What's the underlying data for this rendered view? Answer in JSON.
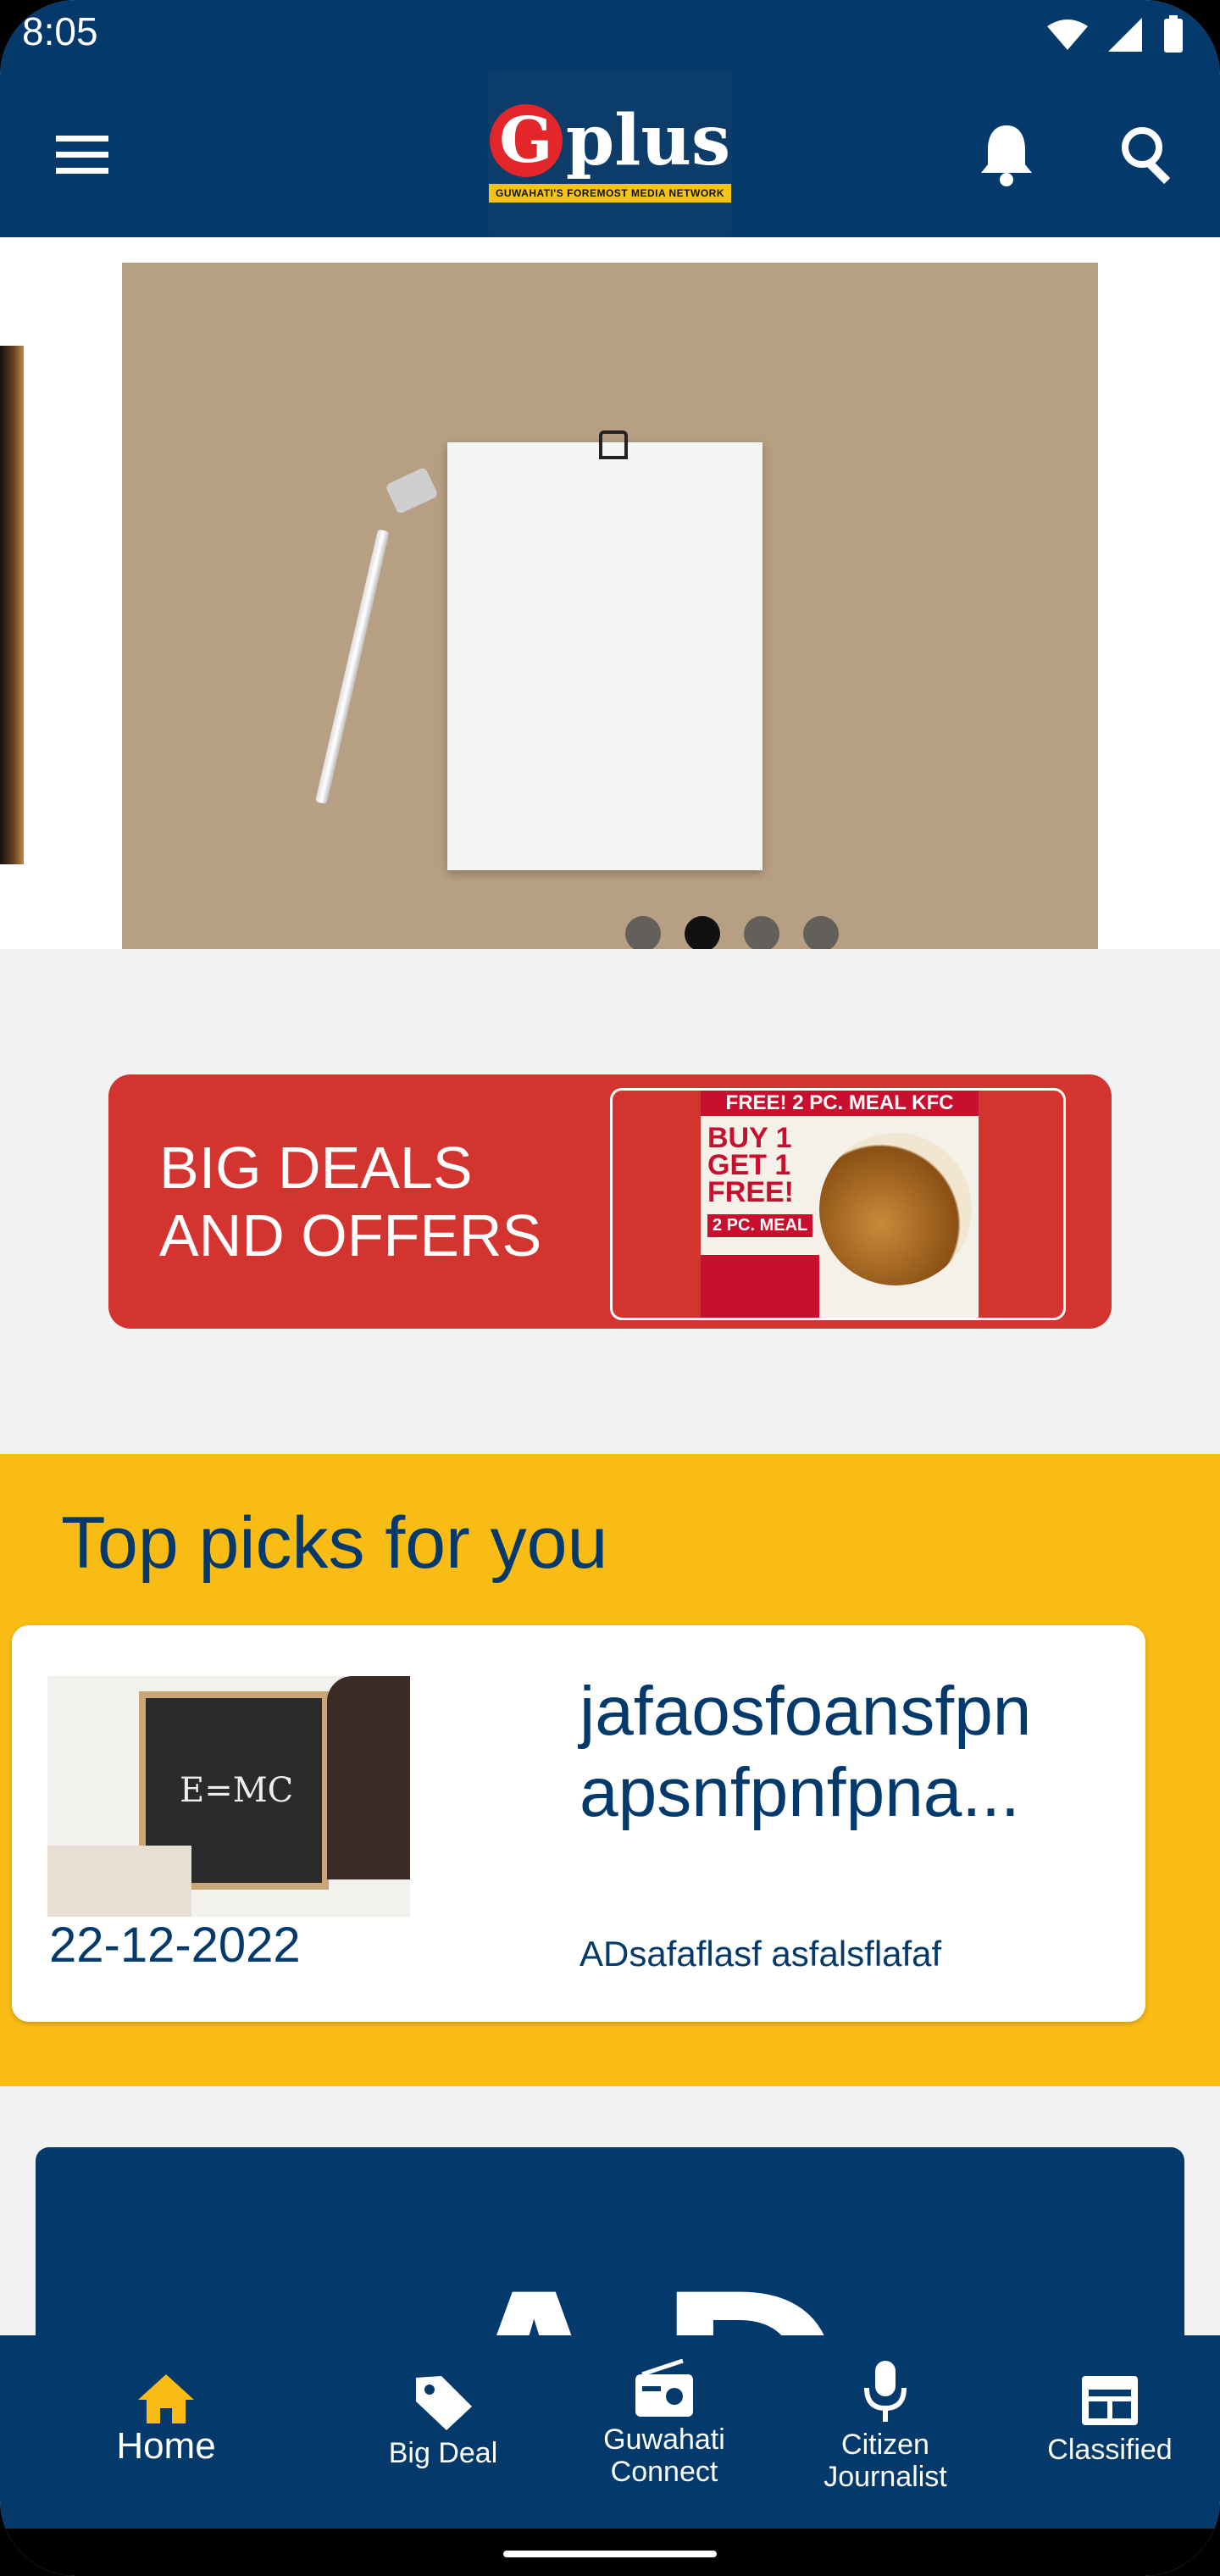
{
  "status": {
    "time": "8:05"
  },
  "appbar": {
    "logo_letter": "G",
    "logo_text": "plus",
    "logo_tagline": "GUWAHATI'S FOREMOST MEDIA NETWORK",
    "icons": [
      "menu-icon",
      "notification-bell-icon",
      "search-icon"
    ]
  },
  "carousel": {
    "slide_count": 4,
    "active_index": 1
  },
  "deals_banner": {
    "text": "BIG DEALS\nAND OFFERS",
    "ad_header": "FREE! 2 PC. MEAL KFC",
    "ad_big": "BUY 1 GET 1 FREE!",
    "ad_meal": "2 PC. MEAL",
    "ad_brand": "KFC"
  },
  "top_picks": {
    "title": "Top picks for you",
    "items": [
      {
        "image_text": "E=MC",
        "date": "22-12-2022",
        "title": "jafaosfoansfpn apsnfpnfpna...",
        "subtitle": "ADsafaflasf asfalsflafaf"
      }
    ]
  },
  "ad_block": {
    "text": "AD"
  },
  "bottom_nav": {
    "items": [
      {
        "label": "Home",
        "icon": "home-icon",
        "active": true,
        "color": "#f9bc14"
      },
      {
        "label": "Big Deal",
        "icon": "tag-icon",
        "active": false
      },
      {
        "label": "Guwahati\nConnect",
        "icon": "radio-icon",
        "active": false
      },
      {
        "label": "Citizen\nJournalist",
        "icon": "microphone-icon",
        "active": false
      },
      {
        "label": "Classified",
        "icon": "newspaper-icon",
        "active": false
      }
    ]
  },
  "colors": {
    "primary": "#033a6b",
    "accent": "#f9bc14",
    "deal_red": "#d33430",
    "background": "#f2f2f2"
  }
}
